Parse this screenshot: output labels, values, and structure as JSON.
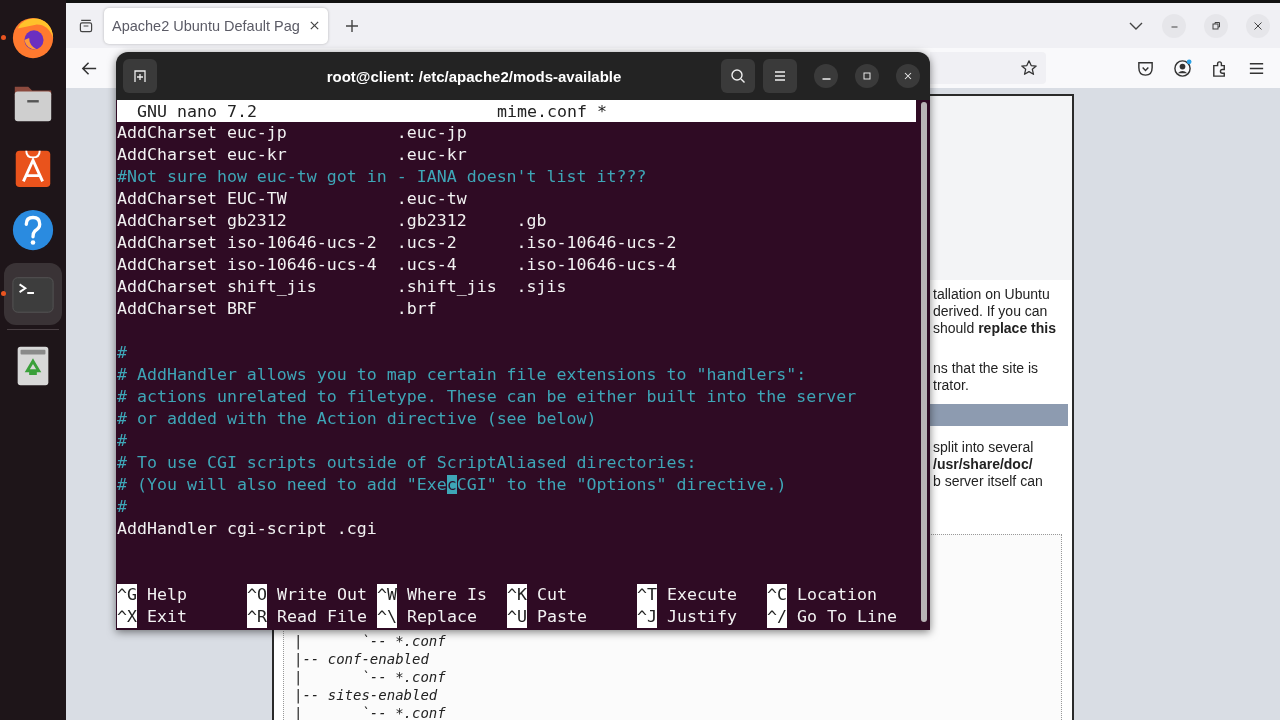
{
  "dock": {
    "items": [
      {
        "kind": "firefox",
        "running": true,
        "selected": false
      },
      {
        "kind": "files",
        "running": false,
        "selected": false
      },
      {
        "kind": "app-center",
        "running": false,
        "selected": false
      },
      {
        "kind": "help",
        "running": false,
        "selected": false
      },
      {
        "kind": "terminal",
        "running": true,
        "selected": true
      },
      {
        "kind": "trash",
        "running": false,
        "selected": false
      }
    ]
  },
  "browser": {
    "tab": {
      "title": "Apache2 Ubuntu Default Pag"
    },
    "page": {
      "blocks": [
        {
          "kind": "text",
          "lines": [
            "tallation on Ubuntu",
            "derived. If you can",
            "should **replace this**"
          ]
        },
        {
          "kind": "text",
          "lines": [
            "ns that the site is",
            "trator."
          ]
        },
        {
          "kind": "bar"
        },
        {
          "kind": "text",
          "lines": [
            "split into several",
            "**/usr/share/doc/**",
            "b server itself can"
          ]
        }
      ],
      "tree_lines": [
        "|       `-- *.conf",
        "|-- conf-enabled",
        "|       `-- *.conf",
        "|-- sites-enabled",
        "|       `-- *.conf"
      ]
    }
  },
  "terminal": {
    "title": "root@client: /etc/apache2/mods-available",
    "nano": {
      "version": "GNU nano 7.2",
      "file": "mime.conf *",
      "lines": [
        {
          "kind": "code",
          "text": "AddCharset euc-jp           .euc-jp"
        },
        {
          "kind": "code",
          "text": "AddCharset euc-kr           .euc-kr"
        },
        {
          "kind": "comment",
          "text": "#Not sure how euc-tw got in - IANA doesn't list it???"
        },
        {
          "kind": "code",
          "text": "AddCharset EUC-TW           .euc-tw"
        },
        {
          "kind": "code",
          "text": "AddCharset gb2312           .gb2312     .gb"
        },
        {
          "kind": "code",
          "text": "AddCharset iso-10646-ucs-2  .ucs-2      .iso-10646-ucs-2"
        },
        {
          "kind": "code",
          "text": "AddCharset iso-10646-ucs-4  .ucs-4      .iso-10646-ucs-4"
        },
        {
          "kind": "code",
          "text": "AddCharset shift_jis        .shift_jis  .sjis"
        },
        {
          "kind": "code",
          "text": "AddCharset BRF              .brf"
        },
        {
          "kind": "blank"
        },
        {
          "kind": "comment",
          "text": "#"
        },
        {
          "kind": "comment",
          "text": "# AddHandler allows you to map certain file extensions to \"handlers\":"
        },
        {
          "kind": "comment",
          "text": "# actions unrelated to filetype. These can be either built into the server"
        },
        {
          "kind": "comment",
          "text": "# or added with the Action directive (see below)"
        },
        {
          "kind": "comment",
          "text": "#"
        },
        {
          "kind": "comment",
          "text": "# To use CGI scripts outside of ScriptAliased directories:"
        },
        {
          "kind": "comment",
          "parts": [
            "# (You will also need to add \"Exe",
            "c",
            "CGI\" to the \"Options\" directive.)"
          ]
        },
        {
          "kind": "comment",
          "text": "#"
        },
        {
          "kind": "code",
          "text": "AddHandler cgi-script .cgi"
        },
        {
          "kind": "blank"
        },
        {
          "kind": "blank"
        }
      ],
      "shortcuts": [
        {
          "key": "^G",
          "label": "Help"
        },
        {
          "key": "^O",
          "label": "Write Out"
        },
        {
          "key": "^W",
          "label": "Where Is"
        },
        {
          "key": "^K",
          "label": "Cut"
        },
        {
          "key": "^T",
          "label": "Execute"
        },
        {
          "key": "^C",
          "label": "Location"
        },
        {
          "key": "^X",
          "label": "Exit"
        },
        {
          "key": "^R",
          "label": "Read File"
        },
        {
          "key": "^\\",
          "label": "Replace"
        },
        {
          "key": "^U",
          "label": "Paste"
        },
        {
          "key": "^J",
          "label": "Justify"
        },
        {
          "key": "^/",
          "label": "Go To Line"
        }
      ]
    }
  }
}
